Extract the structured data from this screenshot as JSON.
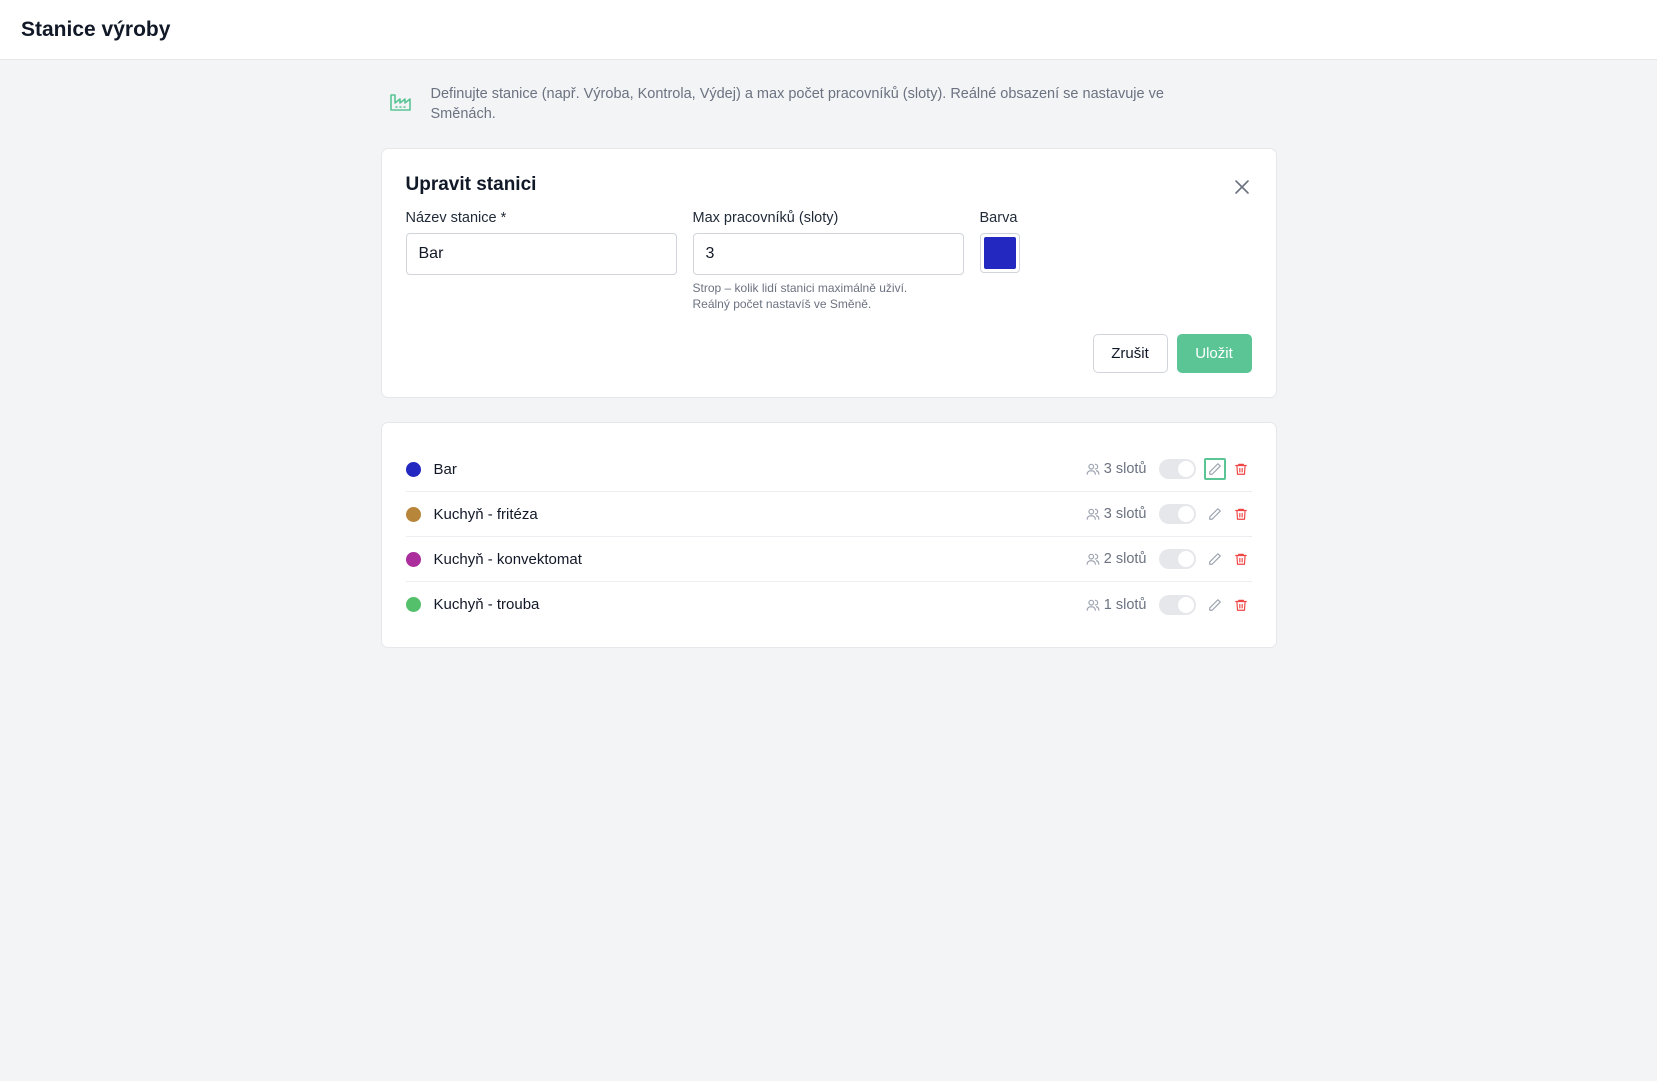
{
  "header": {
    "title": "Stanice výroby"
  },
  "info": {
    "icon": "factory-icon",
    "text": "Definujte stanice (např. Výroba, Kontrola, Výdej) a max počet pracovníků (sloty). Reálné obsazení se nastavuje ve Směnách."
  },
  "edit_form": {
    "title": "Upravit stanici",
    "name_label": "Název stanice *",
    "name_value": "Bar",
    "slots_label": "Max pracovníků (sloty)",
    "slots_value": "3",
    "slots_hint_line1": "Strop – kolik lidí stanici maximálně uživí.",
    "slots_hint_line2": "Reálný počet nastavíš ve Směně.",
    "color_label": "Barva",
    "color_value": "#2329c0",
    "cancel_label": "Zrušit",
    "save_label": "Uložit"
  },
  "stations": [
    {
      "name": "Bar",
      "color": "#2329c0",
      "slots": "3 slotů",
      "active": false
    },
    {
      "name": "Kuchyň - fritéza",
      "color": "#b7863a",
      "slots": "3 slotů",
      "active": false
    },
    {
      "name": "Kuchyň - konvektomat",
      "color": "#ac2e9d",
      "slots": "2 slotů",
      "active": false
    },
    {
      "name": "Kuchyň - trouba",
      "color": "#54c06c",
      "slots": "1 slotů",
      "active": false
    }
  ],
  "colors": {
    "accent": "#5bc596",
    "danger": "#ef4444"
  }
}
